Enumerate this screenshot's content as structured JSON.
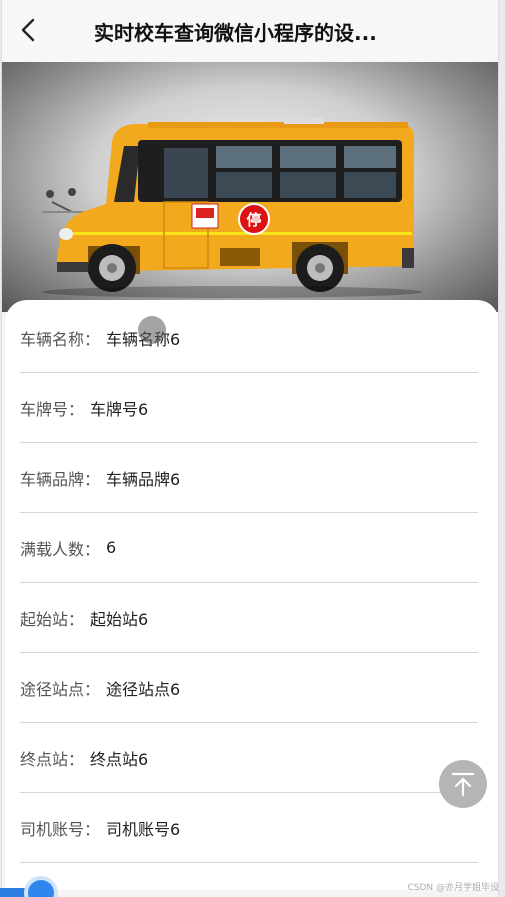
{
  "header": {
    "title": "实时校车查询微信小程序的设..."
  },
  "hero": {
    "stop_sign": "停"
  },
  "details": [
    {
      "label": "车辆名称：",
      "value": "车辆名称6"
    },
    {
      "label": "车牌号：",
      "value": "车牌号6"
    },
    {
      "label": "车辆品牌：",
      "value": "车辆品牌6"
    },
    {
      "label": "满载人数：",
      "value": "6"
    },
    {
      "label": "起始站：",
      "value": "起始站6"
    },
    {
      "label": "途径站点：",
      "value": "途径站点6"
    },
    {
      "label": "终点站：",
      "value": "终点站6"
    },
    {
      "label": "司机账号：",
      "value": "司机账号6"
    }
  ],
  "footer": {
    "watermark": "CSDN @亦月学姐毕设"
  }
}
